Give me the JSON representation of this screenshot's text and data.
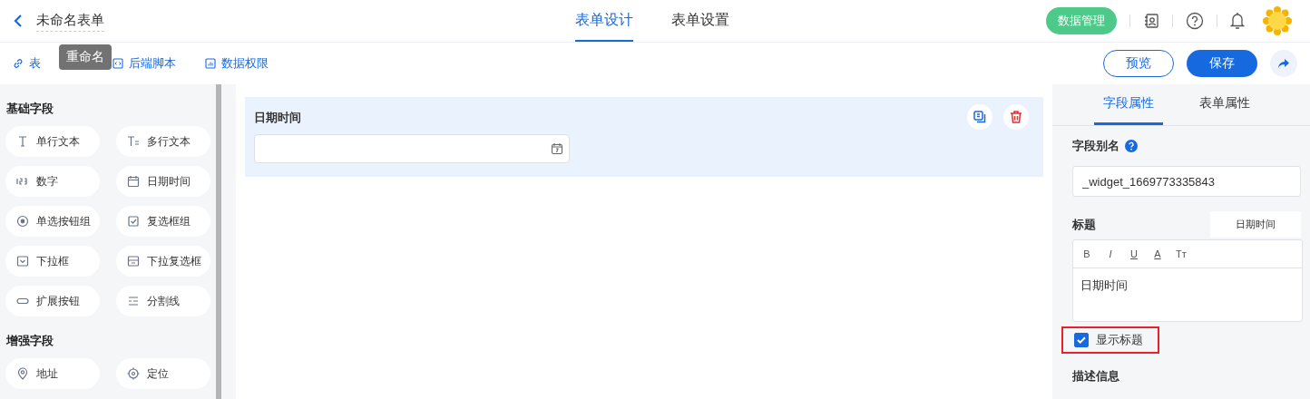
{
  "header": {
    "form_title": "未命名表单",
    "tooltip": "重命名",
    "tabs": [
      {
        "label": "表单设计",
        "selected": true
      },
      {
        "label": "表单设置",
        "selected": false
      }
    ],
    "data_button": "数据管理"
  },
  "toolbar": {
    "links": [
      "表",
      "后端脚本",
      "数据权限"
    ],
    "preview_button": "预览",
    "save_button": "保存"
  },
  "sidebar": {
    "groups": [
      {
        "title": "基础字段",
        "items": [
          "单行文本",
          "多行文本",
          "数字",
          "日期时间",
          "单选按钮组",
          "复选框组",
          "下拉框",
          "下拉复选框",
          "扩展按钮",
          "分割线"
        ]
      },
      {
        "title": "增强字段",
        "items": [
          "地址",
          "定位"
        ]
      }
    ]
  },
  "canvas": {
    "fields": [
      {
        "label": "日期时间",
        "selected": true
      }
    ]
  },
  "properties": {
    "tabs": [
      {
        "label": "字段属性",
        "selected": true
      },
      {
        "label": "表单属性",
        "selected": false
      }
    ],
    "alias_label": "字段别名",
    "alias_value": "_widget_1669773335843",
    "title_label": "标题",
    "title_chip": "日期时间",
    "format_buttons": [
      "B",
      "I",
      "U",
      "A",
      "Tт"
    ],
    "title_value": "日期时间",
    "show_title": {
      "label": "显示标题",
      "checked": true,
      "highlighted": true
    },
    "description_label": "描述信息"
  }
}
